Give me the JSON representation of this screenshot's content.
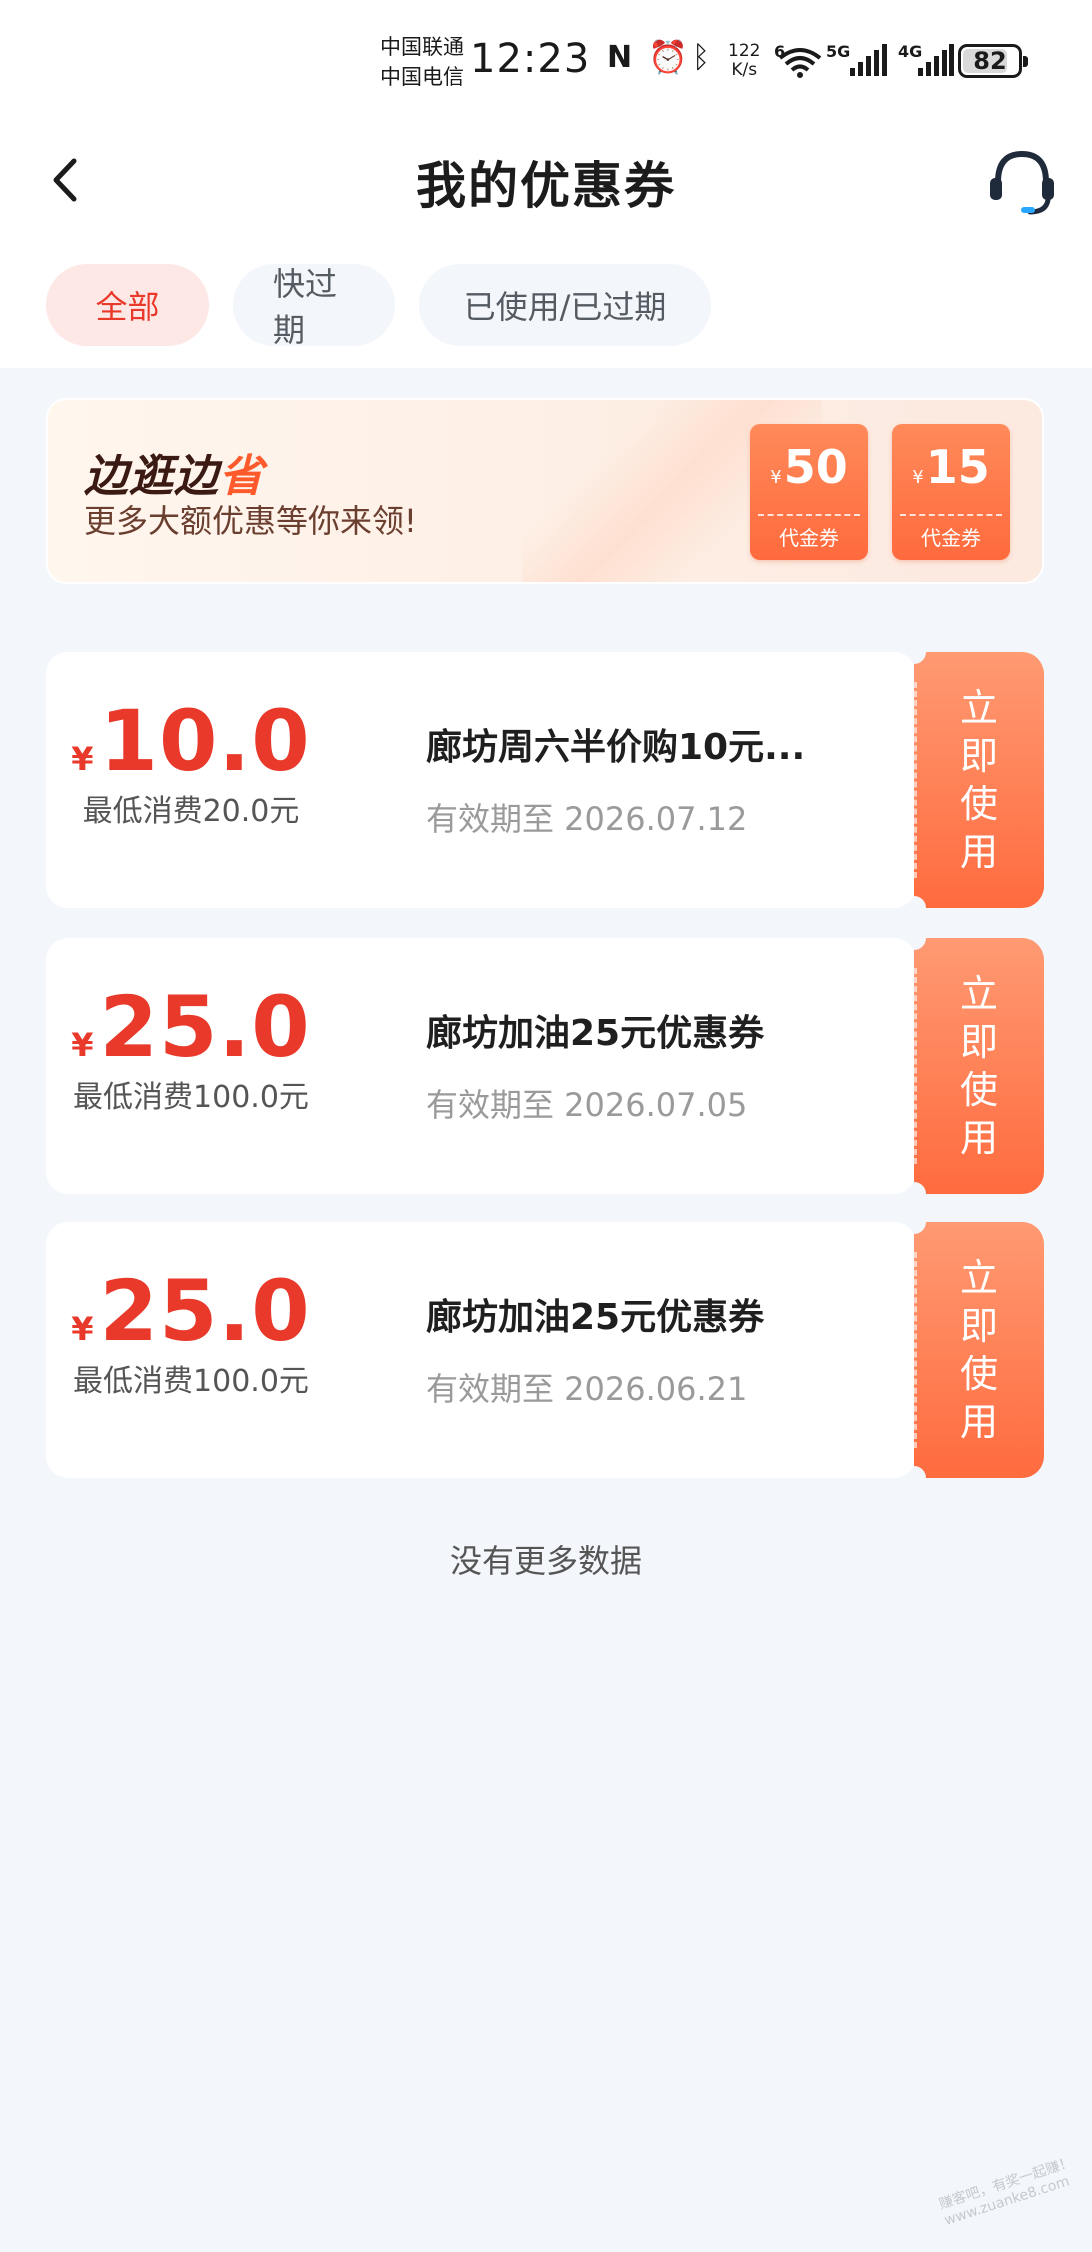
{
  "status_bar": {
    "carrier_1": "中国联通",
    "carrier_2": "中国电信",
    "time": "12:23",
    "net_speed_value": "122",
    "net_speed_unit": "K/s",
    "wifi_label": "6",
    "sig1_label": "5G",
    "sig2_label": "4G",
    "battery": "82",
    "battery_level_percent": 82
  },
  "nav": {
    "title": "我的优惠券",
    "back_icon": "chevron-left-icon",
    "service_icon": "headset-icon"
  },
  "tabs": [
    {
      "label": "全部",
      "active": true
    },
    {
      "label": "快过期",
      "active": false
    },
    {
      "label": "已使用/已过期",
      "active": false
    }
  ],
  "banner": {
    "title_part1": "边逛边",
    "title_part2": "省",
    "subtitle": "更多大额优惠等你来领!",
    "vouchers": [
      {
        "currency": "¥",
        "amount": "50",
        "label": "代金券"
      },
      {
        "currency": "¥",
        "amount": "15",
        "label": "代金券"
      }
    ]
  },
  "coupons": [
    {
      "currency": "¥",
      "amount": "10.0",
      "min_spend": "最低消费20.0元",
      "title": "廊坊周六半价购10元...",
      "expiry": "有效期至 2026.07.12",
      "action": "立即使用"
    },
    {
      "currency": "¥",
      "amount": "25.0",
      "min_spend": "最低消费100.0元",
      "title": "廊坊加油25元优惠券",
      "expiry": "有效期至 2026.07.05",
      "action": "立即使用"
    },
    {
      "currency": "¥",
      "amount": "25.0",
      "min_spend": "最低消费100.0元",
      "title": "廊坊加油25元优惠券",
      "expiry": "有效期至 2026.06.21",
      "action": "立即使用"
    }
  ],
  "footer": {
    "no_more": "没有更多数据"
  },
  "watermark": "赚客吧，有奖一起赚！ www.zuanke8.com",
  "colors": {
    "accent_red": "#e8392b",
    "button_orange": "#ff6b3f",
    "page_bg": "#f3f6fa"
  }
}
